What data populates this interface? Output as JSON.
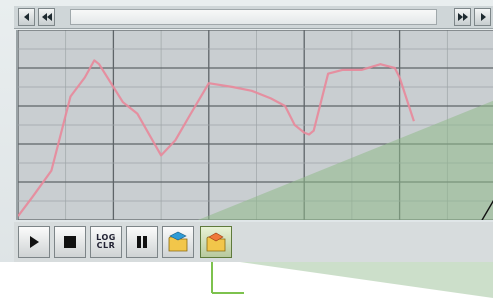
{
  "scrollbar": {
    "left_buttons": [
      "scroll-left",
      "scroll-first"
    ],
    "right_buttons": [
      "scroll-last",
      "scroll-right"
    ]
  },
  "toolbar": {
    "buttons": [
      {
        "name": "play-button",
        "icon": "play-icon"
      },
      {
        "name": "stop-button",
        "icon": "stop-icon"
      },
      {
        "name": "log-clear-button",
        "icon": "log-clear-icon",
        "label_line1": "LOG",
        "label_line2": "CLR"
      },
      {
        "name": "pause-button",
        "icon": "pause-icon"
      },
      {
        "name": "open-file-button",
        "icon": "folder-blue-icon"
      },
      {
        "name": "save-file-button",
        "icon": "folder-orange-icon"
      }
    ]
  },
  "chart_data": {
    "type": "line",
    "grid": true,
    "series": [
      {
        "color": "#e8889a",
        "x": [
          0,
          3,
          7,
          11,
          14,
          16,
          17,
          20,
          22,
          25,
          30,
          33,
          36,
          40,
          45,
          49,
          53,
          56,
          58,
          60,
          61,
          62,
          65,
          68,
          72,
          76,
          79,
          80,
          83
        ],
        "y": [
          2,
          12,
          26,
          65,
          75,
          84,
          82,
          70,
          62,
          56,
          34,
          42,
          55,
          72,
          70,
          68,
          64,
          60,
          50,
          46,
          45,
          47,
          77,
          79,
          79,
          82,
          80,
          75,
          52
        ]
      }
    ],
    "xlim": [
      0,
      100
    ],
    "ylim": [
      0,
      100
    ]
  },
  "colors": {
    "plot_bg": "#c9ced1",
    "grid_dark": "#5e6468",
    "grid_light": "#9ea5a8",
    "overlay_green": "#8fb98a",
    "callout_line": "#7dc24e"
  }
}
